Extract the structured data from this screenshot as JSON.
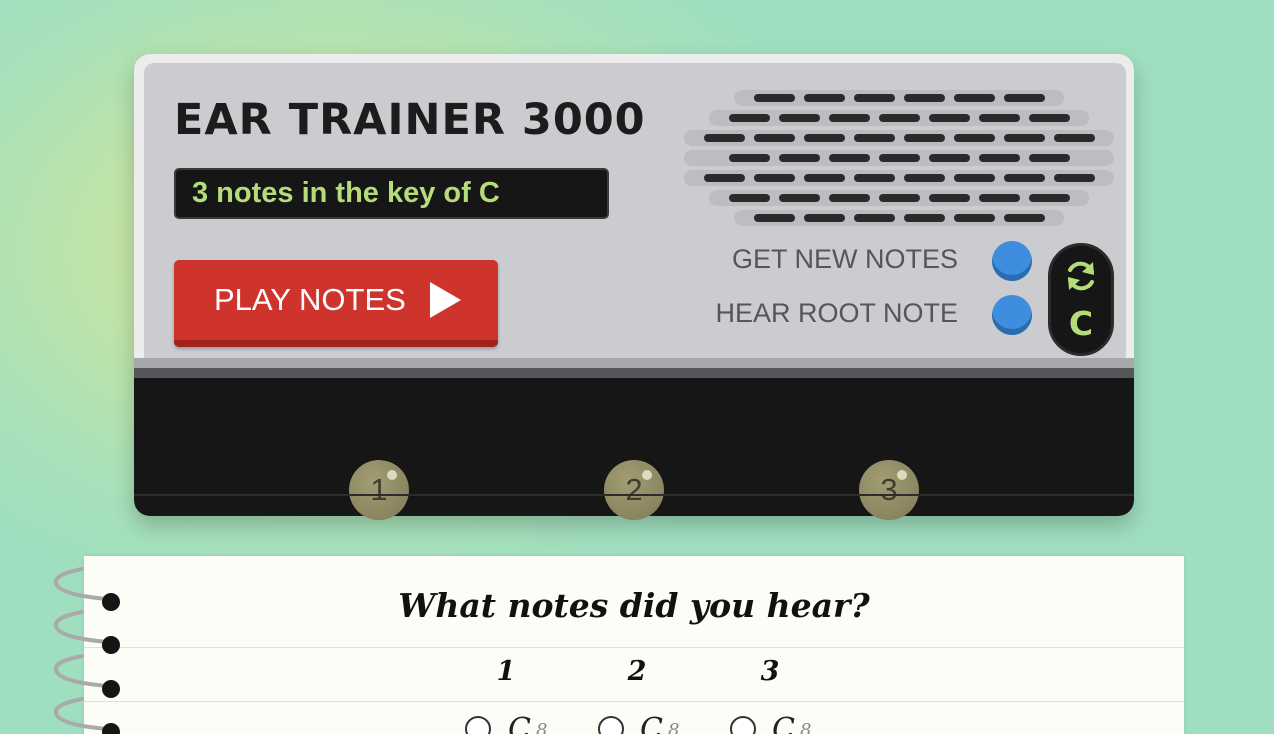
{
  "device": {
    "title": "EAR TRAINER 3000",
    "display_text": "3 notes in the key of C",
    "play_label": "PLAY NOTES",
    "get_new_notes_label": "GET NEW NOTES",
    "hear_root_note_label": "HEAR ROOT NOTE",
    "current_key": "C",
    "note_buttons": [
      "1",
      "2",
      "3"
    ]
  },
  "worksheet": {
    "question": "What notes did you hear?",
    "columns": [
      "1",
      "2",
      "3"
    ],
    "first_option": {
      "label": "C",
      "accidental": "8"
    }
  },
  "colors": {
    "accent_green": "#b6dc7a",
    "play_red": "#cf342c",
    "control_blue": "#3f8ddf",
    "knob_gold": "#8a8460"
  },
  "icons": {
    "play": "play-triangle-icon",
    "refresh": "refresh-icon"
  }
}
